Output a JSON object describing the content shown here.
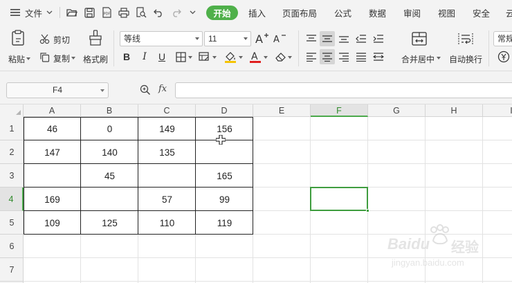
{
  "menubar": {
    "file_label": "文件",
    "tabs": [
      "开始",
      "插入",
      "页面布局",
      "公式",
      "数据",
      "审阅",
      "视图",
      "安全"
    ],
    "active_tab": "开始",
    "overflow_label": "云"
  },
  "ribbon": {
    "paste_label": "粘贴",
    "cut_label": "剪切",
    "copy_label": "复制",
    "format_painter_label": "格式刷",
    "font_name": "等线",
    "font_size": "11",
    "merge_center_label": "合并居中",
    "wrap_text_label": "自动换行",
    "number_format": "常规",
    "accent_color": "#4fb04a",
    "font_color": "#e02020",
    "fill_color": "#f5c400"
  },
  "formula_bar": {
    "name_box": "F4",
    "fx_label": "fx",
    "formula_value": ""
  },
  "sheet": {
    "columns": [
      "A",
      "B",
      "C",
      "D",
      "E",
      "F",
      "G",
      "H",
      "I"
    ],
    "rows": [
      "1",
      "2",
      "3",
      "4",
      "5",
      "6",
      "7"
    ],
    "active_column": "F",
    "active_row": "4",
    "cells": [
      [
        "46",
        "0",
        "149",
        "156"
      ],
      [
        "147",
        "140",
        "135",
        ""
      ],
      [
        "",
        "45",
        "",
        "165"
      ],
      [
        "169",
        "",
        "57",
        "99"
      ],
      [
        "109",
        "125",
        "110",
        "119"
      ]
    ]
  },
  "watermark": {
    "brand": "Baidu",
    "brand_cn": "经验",
    "url": "jingyan.baidu.com"
  }
}
